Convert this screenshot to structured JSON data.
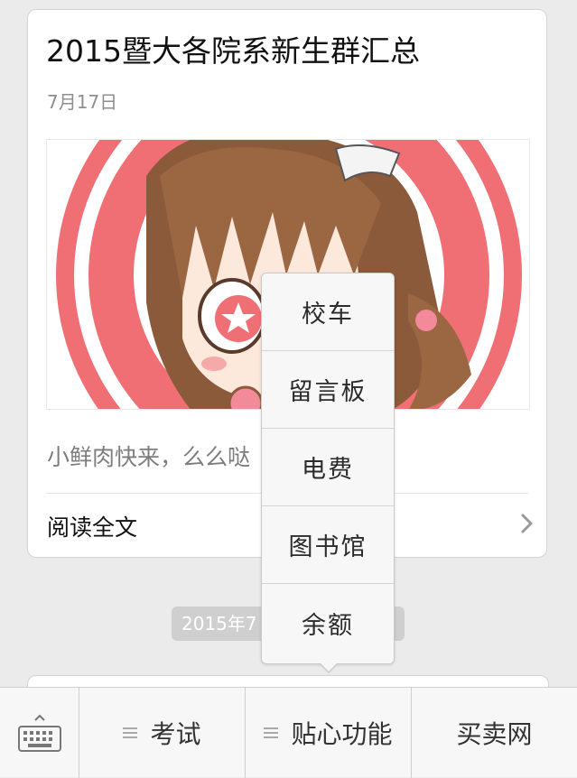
{
  "article": {
    "title": "2015暨大各院系新生群汇总",
    "date": "7月17日",
    "summary": "小鲜肉快来，么么哒",
    "read_more": "阅读全文"
  },
  "timestamp_pill": "2015年7",
  "popup_menu": {
    "items": [
      "校车",
      "留言板",
      "电费",
      "图书馆",
      "余额"
    ]
  },
  "bottom_bar": {
    "keyboard_icon": "keyboard-icon",
    "menus": [
      {
        "label": "考试",
        "has_submenu": true
      },
      {
        "label": "贴心功能",
        "has_submenu": true
      },
      {
        "label": "买卖网",
        "has_submenu": false
      }
    ]
  },
  "colors": {
    "background": "#ebebeb",
    "cover_red": "#ef6f74",
    "popup_bg": "#f7f7f7"
  }
}
